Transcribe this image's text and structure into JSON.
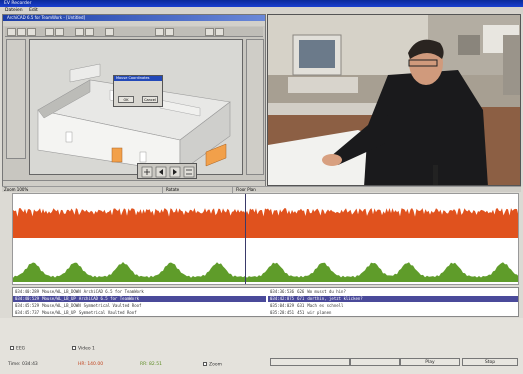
{
  "window": {
    "title": "EV Recorder",
    "menu": [
      "Dateien",
      "Edit"
    ]
  },
  "software": {
    "title": "ArchiCAD 6.5 for TeamWork - [Untitled]",
    "dialog": {
      "title": "Mouse Coordinates",
      "ok": "OK",
      "cancel": "Cancel"
    }
  },
  "status_bar": {
    "left": "Zoom 100%",
    "mid": "Rotate",
    "right": "Floor Plan"
  },
  "event_log": {
    "left_rows": [
      {
        "time": "034:40:289",
        "event": "Mouse/WL_LB_DOWN",
        "detail": "ArchiCAD 6.5 for TeamWork"
      },
      {
        "time": "034:40:529",
        "event": "Mouse/WL_LB_UP",
        "detail": "ArchiCAD 6.5 for TeamWork"
      },
      {
        "time": "034:45:529",
        "event": "Mouse/WL_LB_DOWN",
        "detail": "Symmetrical Vaulted Roof"
      },
      {
        "time": "034:45:737",
        "event": "Mouse/WL_LB_UP",
        "detail": "Symmetrical Vaulted Roof"
      }
    ],
    "right_rows": [
      {
        "time": "034:36:536",
        "id": "626",
        "text": "Wo musst du hin?"
      },
      {
        "time": "034:42:875",
        "id": "671",
        "text": "dorthin, jetzt klicken?"
      },
      {
        "time": "035:04:029",
        "id": "631",
        "text": "Mach es schnell"
      },
      {
        "time": "035:28:451",
        "id": "451",
        "text": "wir planen"
      }
    ]
  },
  "controls": {
    "eeg_label": "EEG",
    "video_label": "Video 1",
    "time_label": "Time: 034:43",
    "readout_a": "HR: 140.00",
    "readout_b": "RR: 82.51",
    "zoom_label": "Zoom",
    "play_label": "Play",
    "stop_label": "Stop"
  },
  "colors": {
    "signal_top": "#e0521e",
    "signal_bottom": "#5f9c2a",
    "highlight": "#4a4a9a"
  }
}
